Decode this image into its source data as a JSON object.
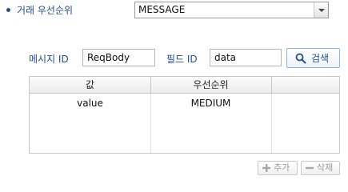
{
  "priority": {
    "label": "거래 우선순위",
    "selected": "MESSAGE"
  },
  "search": {
    "message_id_label": "메시지 ID",
    "message_id_value": "ReqBody",
    "field_id_label": "필드 ID",
    "field_id_value": "data",
    "search_button": "검색"
  },
  "grid": {
    "columns": [
      "값",
      "우선순위"
    ],
    "rows": [
      {
        "value": "value",
        "priority": "MEDIUM"
      }
    ]
  },
  "actions": {
    "add": "추가",
    "delete": "삭제"
  },
  "icons": {
    "search": "search-icon",
    "add": "plus-icon",
    "delete": "minus-icon",
    "dropdown": "chevron-down-icon"
  },
  "colors": {
    "label": "#1f4e8c",
    "accent_border": "#8fb3dc"
  }
}
